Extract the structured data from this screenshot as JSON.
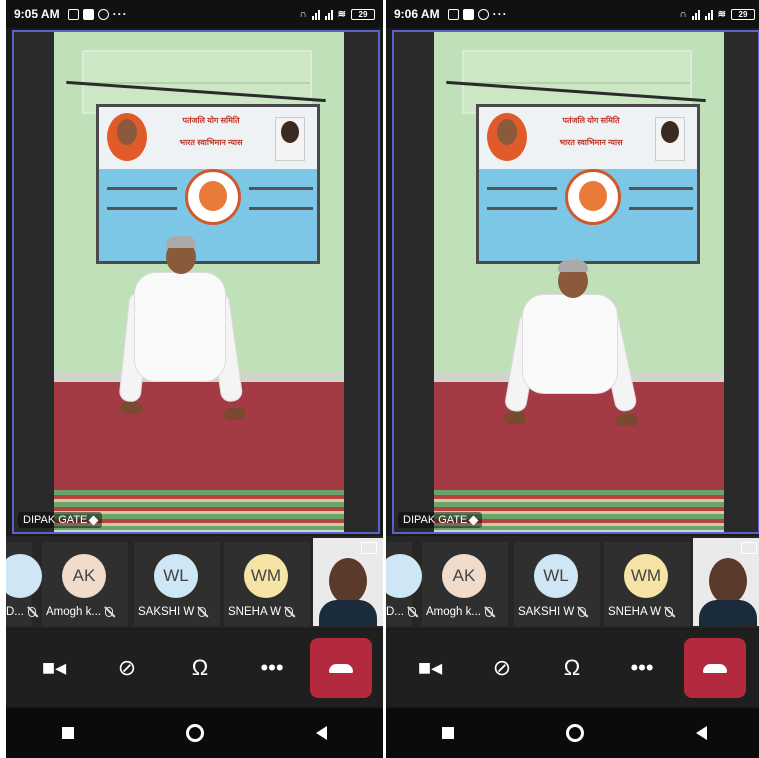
{
  "screens": [
    {
      "time": "9:05 AM",
      "battery": "29",
      "presenter": "DIPAK GATE",
      "participants": [
        {
          "initials": "",
          "name": "D...",
          "avatar_color": "#cfe6f5"
        },
        {
          "initials": "AK",
          "name": "Amogh k...",
          "avatar_color": "#f1dccb"
        },
        {
          "initials": "WL",
          "name": "SAKSHI W",
          "avatar_color": "#cfe6f5"
        },
        {
          "initials": "WM",
          "name": "SNEHA W",
          "avatar_color": "#f6e3a6"
        }
      ]
    },
    {
      "time": "9:06 AM",
      "battery": "29",
      "presenter": "DIPAK GATE",
      "participants": [
        {
          "initials": "",
          "name": "D...",
          "avatar_color": "#cfe6f5"
        },
        {
          "initials": "AK",
          "name": "Amogh k...",
          "avatar_color": "#f1dccb"
        },
        {
          "initials": "WL",
          "name": "SAKSHI W",
          "avatar_color": "#cfe6f5"
        },
        {
          "initials": "WM",
          "name": "SNEHA W",
          "avatar_color": "#f6e3a6"
        }
      ]
    }
  ],
  "banner_text": {
    "line1": "पतंजलि योग समिति",
    "line2": "भारत स्वाभिमान न्यास"
  },
  "controls": [
    "camera-icon",
    "mic-off-icon",
    "headset-icon",
    "more-icon",
    "hang-up-icon"
  ],
  "colors": {
    "accent_border": "#5b63c9",
    "hangup": "#b3293d"
  }
}
